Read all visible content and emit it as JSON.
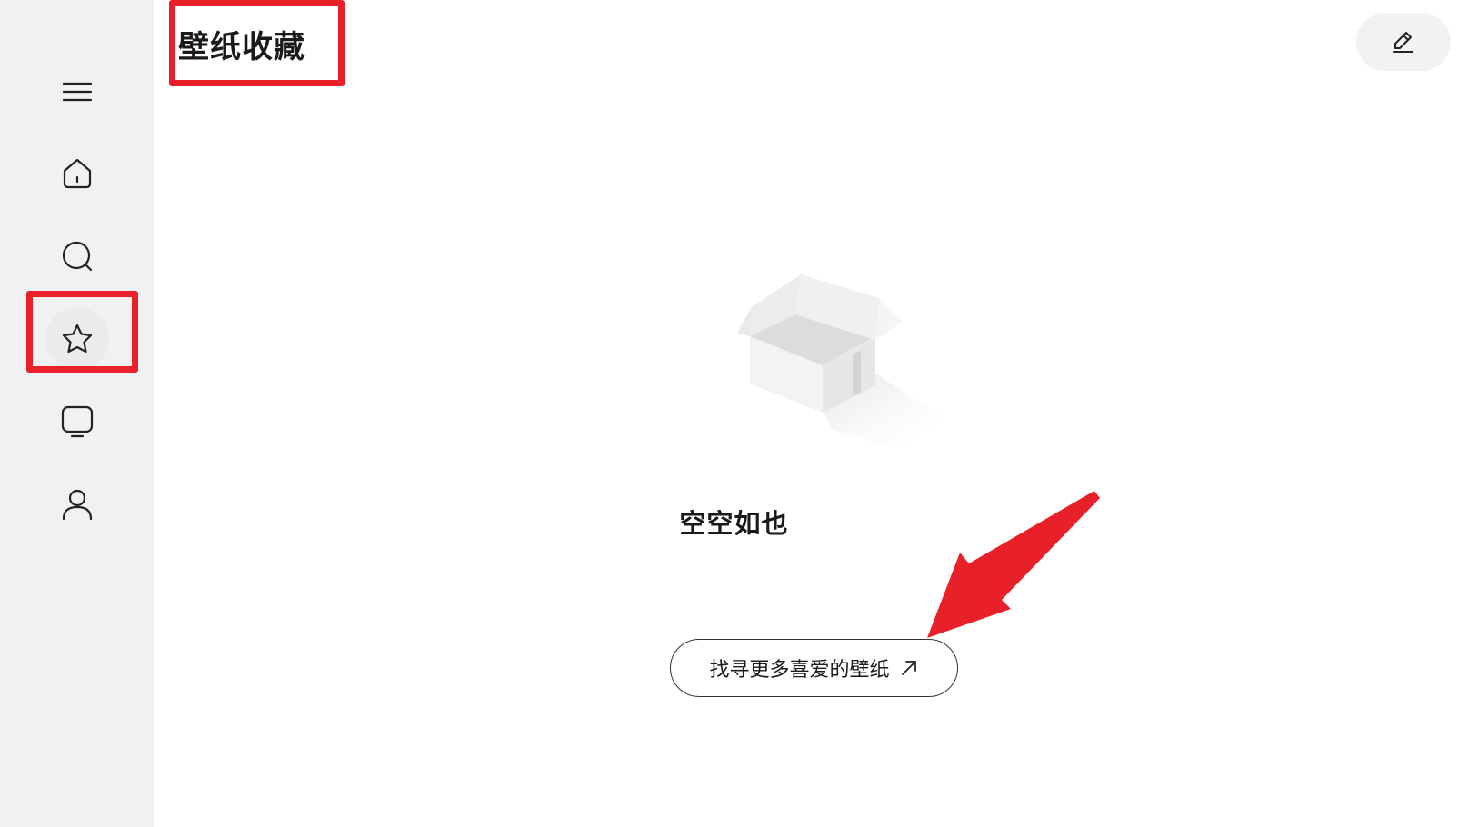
{
  "header": {
    "title": "壁纸收藏"
  },
  "sidebar": {
    "items": [
      {
        "name": "menu",
        "icon": "menu-icon"
      },
      {
        "name": "home",
        "icon": "home-icon"
      },
      {
        "name": "search",
        "icon": "search-icon"
      },
      {
        "name": "favorites",
        "icon": "star-icon",
        "active": true
      },
      {
        "name": "display",
        "icon": "monitor-icon"
      },
      {
        "name": "profile",
        "icon": "user-icon"
      }
    ]
  },
  "toolbar": {
    "edit_icon": "pencil-icon"
  },
  "empty_state": {
    "illustration": "open-box-illustration",
    "message": "空空如也",
    "action_label": "找寻更多喜爱的壁纸",
    "action_icon": "arrow-up-right-icon"
  },
  "annotations": {
    "highlight_color": "#e8202a"
  }
}
